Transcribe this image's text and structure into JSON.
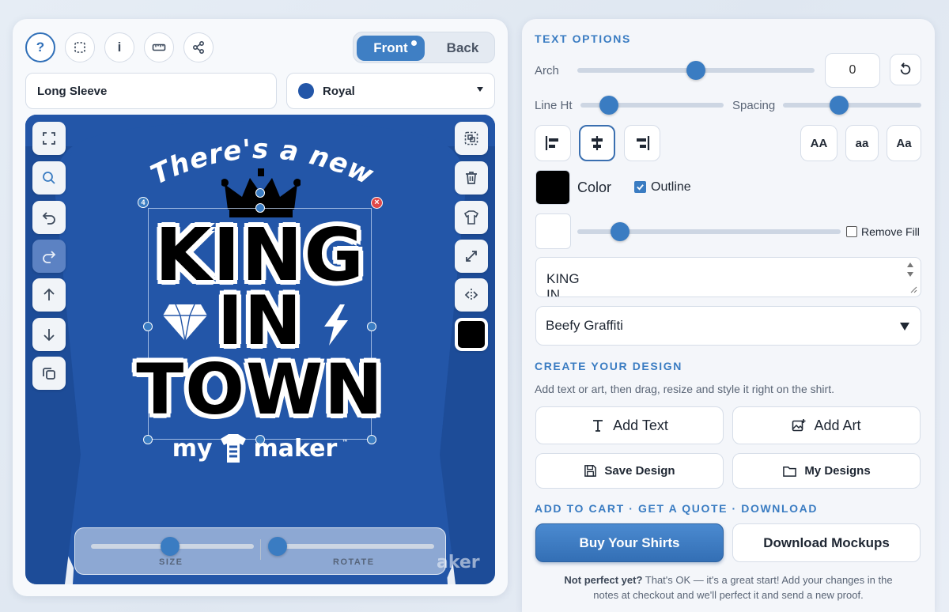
{
  "toolbar": {
    "help_label": "?",
    "info_label": "i"
  },
  "view_toggle": {
    "front": "Front",
    "back": "Back"
  },
  "product": {
    "style": "Long Sleeve",
    "color_name": "Royal",
    "color_hex": "#2356a8"
  },
  "design": {
    "arc_text": "There's a new",
    "line1": "KING",
    "line2": "IN",
    "line3": "TOWN",
    "brand_my": "my",
    "brand_maker": "maker",
    "brand_tm": "™",
    "brand_watermark": "aker",
    "layer_badge": "4",
    "fill_color": "#000000"
  },
  "canvas_sliders": {
    "size_label": "SIZE",
    "rotate_label": "ROTATE"
  },
  "text_options": {
    "title": "TEXT OPTIONS",
    "arch_label": "Arch",
    "arch_value": "0",
    "line_ht_label": "Line Ht",
    "spacing_label": "Spacing",
    "case_upper": "AA",
    "case_lower": "aa",
    "case_title": "Aa",
    "color_label": "Color",
    "outline_label": "Outline",
    "remove_fill_label": "Remove Fill",
    "text_value": "KING\nIN\nTOWN",
    "font_name": "Beefy Graffiti"
  },
  "create": {
    "title": "CREATE YOUR DESIGN",
    "help": "Add text or art, then drag, resize and style it right on the shirt.",
    "add_text": "Add Text",
    "add_art": "Add Art",
    "save_design": "Save Design",
    "my_designs": "My Designs"
  },
  "cart": {
    "title": "ADD TO CART · GET A QUOTE · DOWNLOAD",
    "buy": "Buy Your Shirts",
    "download": "Download Mockups",
    "note_bold": "Not perfect yet?",
    "note_rest": " That's OK — it's a great start! Add your changes in the",
    "note_line2": "notes at checkout and we'll perfect it and send a new proof."
  },
  "colors": {
    "accent": "#3a7cc2",
    "shirt": "#2356a8",
    "buy_btn": "#3f7fc4"
  }
}
